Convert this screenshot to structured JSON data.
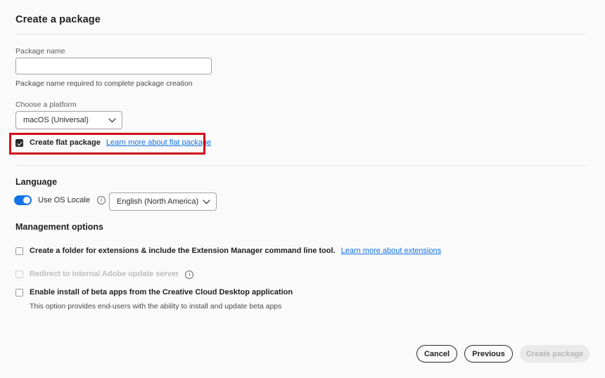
{
  "header": {
    "title": "Create a package"
  },
  "package_name": {
    "label": "Package name",
    "value": "",
    "placeholder": "",
    "helper": "Package name required to complete package creation"
  },
  "platform": {
    "label": "Choose a platform",
    "selected": "macOS (Universal)",
    "options": [
      "macOS (Universal)"
    ]
  },
  "flat_package": {
    "label": "Create flat package",
    "checked": true,
    "link": "Learn more about flat package",
    "highlight_color": "#d00f17"
  },
  "language": {
    "heading": "Language",
    "toggle_label": "Use OS Locale",
    "toggle_on": true,
    "toggle_color": "#1473e6",
    "info_glyph": "i",
    "selected": "English (North America)",
    "options": [
      "English (North America)"
    ]
  },
  "management": {
    "heading": "Management options",
    "options": [
      {
        "label": "Create a folder for extensions & include the Extension Manager command line tool.",
        "checked": false,
        "disabled": false,
        "link": "Learn more about extensions"
      },
      {
        "label": "Redirect to internal Adobe update server",
        "checked": false,
        "disabled": true,
        "info_glyph": "i"
      },
      {
        "label": "Enable install of beta apps from the Creative Cloud Desktop application",
        "checked": false,
        "disabled": false,
        "description": "This option provides end-users with the ability to install and update beta apps"
      }
    ]
  },
  "footer": {
    "cancel_label": "Cancel",
    "previous_label": "Previous",
    "create_label": "Create package",
    "create_disabled": true
  },
  "colors": {
    "link": "#1473e6",
    "accent": "#1473e6",
    "highlight": "#d00f17",
    "background": "#fafafa"
  }
}
